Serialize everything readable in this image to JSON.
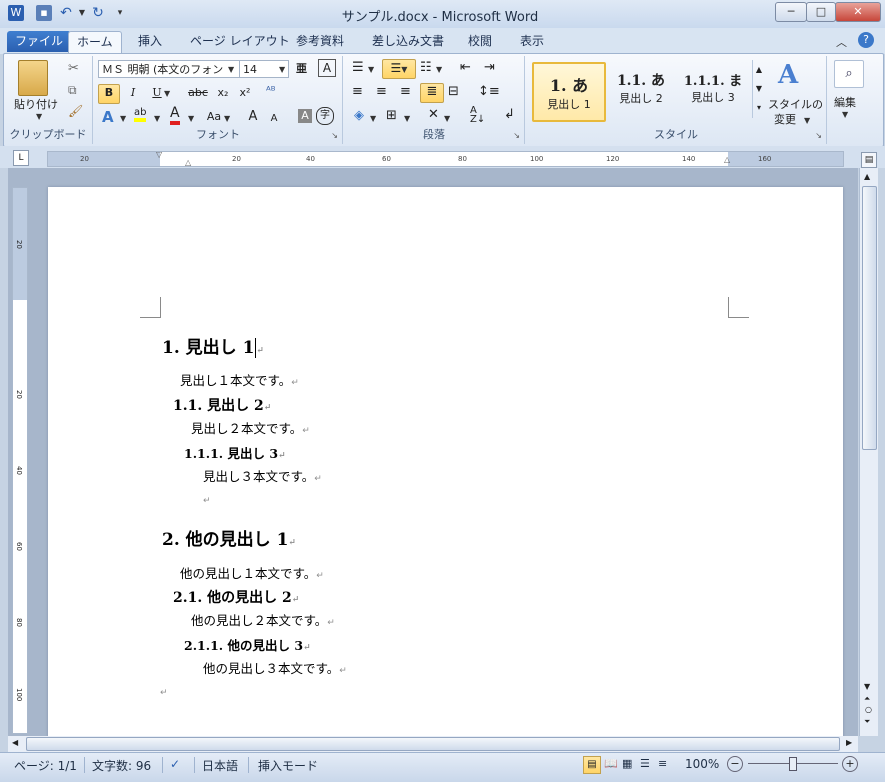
{
  "window": {
    "title": "サンプル.docx - Microsoft Word",
    "app_icon": "W"
  },
  "tabs": [
    {
      "label": "ファイル"
    },
    {
      "label": "ホーム"
    },
    {
      "label": "挿入"
    },
    {
      "label": "ページ レイアウト"
    },
    {
      "label": "参考資料"
    },
    {
      "label": "差し込み文書"
    },
    {
      "label": "校閲"
    },
    {
      "label": "表示"
    }
  ],
  "ribbon": {
    "clipboard": {
      "paste_label": "貼り付け",
      "group_label": "クリップボード"
    },
    "font": {
      "font_name": "ＭＳ 明朝 (本文のフォン",
      "font_size": "14",
      "group_label": "フォント",
      "bold": "B",
      "italic": "I",
      "underline": "U",
      "strike": "abc",
      "sub": "x₂",
      "sup": "x²",
      "case": "Aa",
      "grow": "A",
      "shrink": "A"
    },
    "paragraph": {
      "group_label": "段落"
    },
    "styles": {
      "group_label": "スタイル",
      "items": [
        {
          "preview": "1. あ",
          "label": "見出し 1"
        },
        {
          "preview": "1.1. あ",
          "label": "見出し 2"
        },
        {
          "preview": "1.1.1. ま",
          "label": "見出し 3"
        }
      ],
      "change_label_1": "スタイルの",
      "change_label_2": "変更"
    },
    "editing": {
      "label": "編集"
    }
  },
  "ruler_labels": [
    "20",
    "20",
    "40",
    "60",
    "80",
    "100",
    "120",
    "140",
    "160"
  ],
  "vruler_labels": [
    "20",
    "20",
    "40",
    "60",
    "80",
    "100"
  ],
  "document": {
    "lines": [
      {
        "kind": "h1",
        "text": "1. 見出し 1"
      },
      {
        "kind": "body1",
        "text": "見出し１本文です。"
      },
      {
        "kind": "h2",
        "text": "1.1. 見出し 2"
      },
      {
        "kind": "body2",
        "text": "見出し２本文です。"
      },
      {
        "kind": "h3",
        "text": "1.1.1. 見出し 3"
      },
      {
        "kind": "body3",
        "text": "見出し３本文です。"
      },
      {
        "kind": "empty",
        "text": ""
      },
      {
        "kind": "h1",
        "text": "2. 他の見出し 1"
      },
      {
        "kind": "body1",
        "text": "他の見出し１本文です。"
      },
      {
        "kind": "h2",
        "text": "2.1. 他の見出し 2"
      },
      {
        "kind": "body2",
        "text": "他の見出し２本文です。"
      },
      {
        "kind": "h3",
        "text": "2.1.1. 他の見出し 3"
      },
      {
        "kind": "body3",
        "text": "他の見出し３本文です。"
      },
      {
        "kind": "empty",
        "text": ""
      }
    ],
    "paragraph_mark": "↵"
  },
  "status": {
    "page": "ページ: 1/1",
    "words": "文字数: 96",
    "language": "日本語",
    "mode": "挿入モード",
    "zoom": "100%"
  },
  "colors": {
    "accent": "#2b5fb0",
    "highlight": "#ffd466",
    "red_text": "#e02020"
  }
}
